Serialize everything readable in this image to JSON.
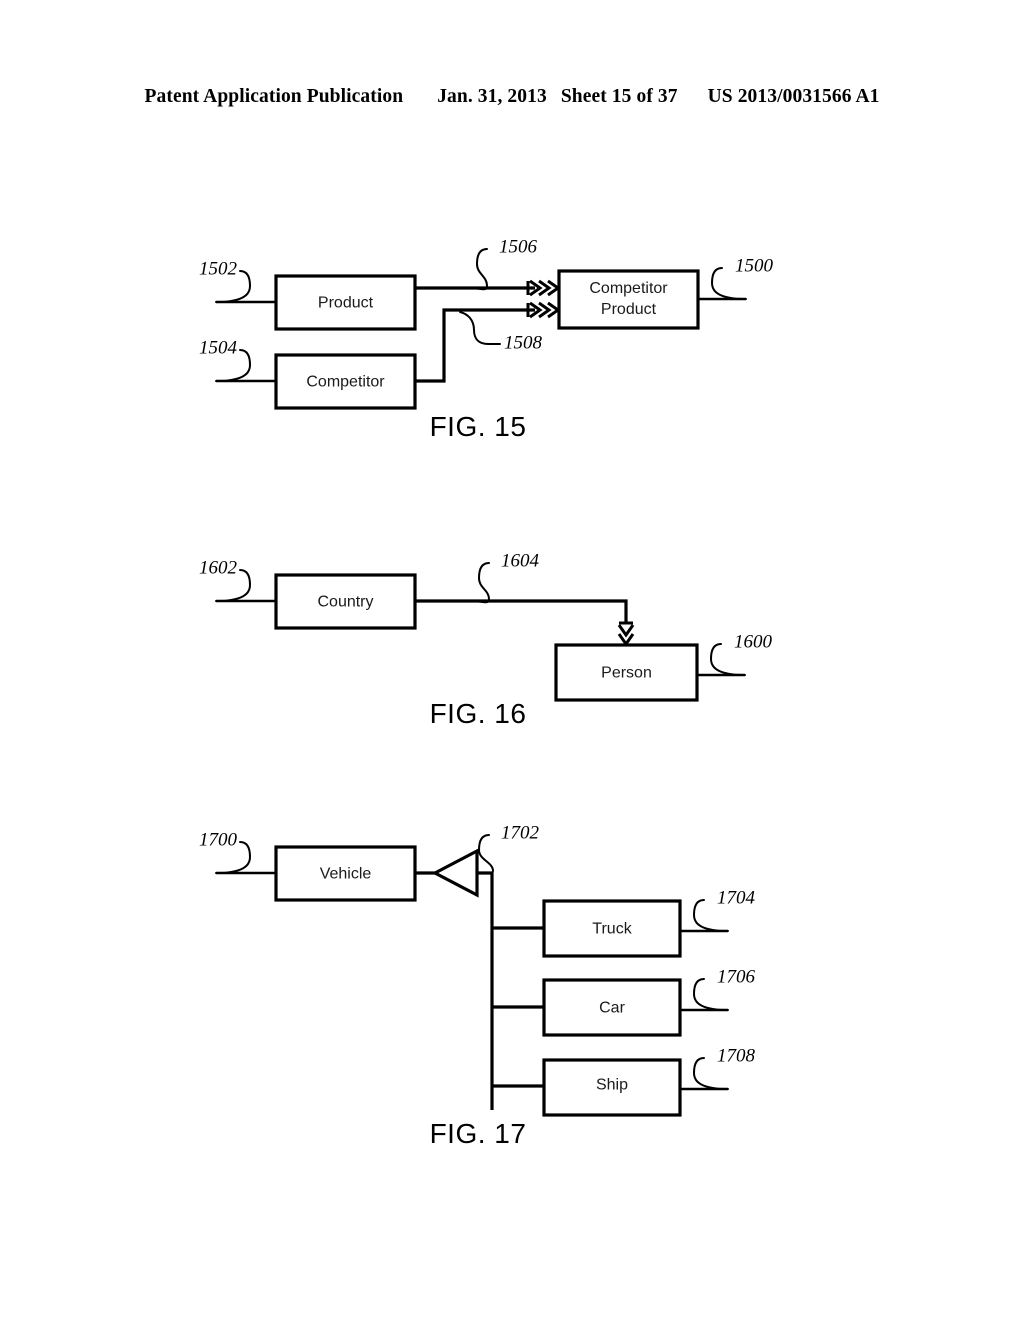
{
  "header": {
    "publication": "Patent Application Publication",
    "date": "Jan. 31, 2013",
    "sheet": "Sheet 15 of 37",
    "patent_number": "US 2013/0031566 A1"
  },
  "figures": [
    {
      "caption": "FIG. 15",
      "nodes": [
        {
          "id": "product",
          "label": "Product",
          "ref": "1502"
        },
        {
          "id": "competitor",
          "label": "Competitor",
          "ref": "1504"
        },
        {
          "id": "competitor_product",
          "label_line1": "Competitor",
          "label_line2": "Product",
          "ref": "1500"
        }
      ],
      "edges": [
        {
          "id": "edge-product-to-competitor-product",
          "ref": "1506",
          "from": "product",
          "to": "competitor_product",
          "arrow": "triple-chevron"
        },
        {
          "id": "edge-competitor-to-competitor-product",
          "ref": "1508",
          "from": "competitor",
          "to": "competitor_product",
          "arrow": "triple-chevron"
        }
      ]
    },
    {
      "caption": "FIG. 16",
      "nodes": [
        {
          "id": "country",
          "label": "Country",
          "ref": "1602"
        },
        {
          "id": "person",
          "label": "Person",
          "ref": "1600"
        }
      ],
      "edges": [
        {
          "id": "edge-country-to-person",
          "ref": "1604",
          "from": "country",
          "to": "person",
          "arrow": "double-chevron-down"
        }
      ]
    },
    {
      "caption": "FIG. 17",
      "nodes": [
        {
          "id": "vehicle",
          "label": "Vehicle",
          "ref": "1700"
        },
        {
          "id": "truck",
          "label": "Truck",
          "ref": "1704"
        },
        {
          "id": "car",
          "label": "Car",
          "ref": "1706"
        },
        {
          "id": "ship",
          "label": "Ship",
          "ref": "1708"
        }
      ],
      "edges": [
        {
          "id": "edge-generalization",
          "ref": "1702",
          "from": [
            "truck",
            "car",
            "ship"
          ],
          "to": "vehicle",
          "arrow": "hollow-triangle"
        }
      ]
    }
  ]
}
